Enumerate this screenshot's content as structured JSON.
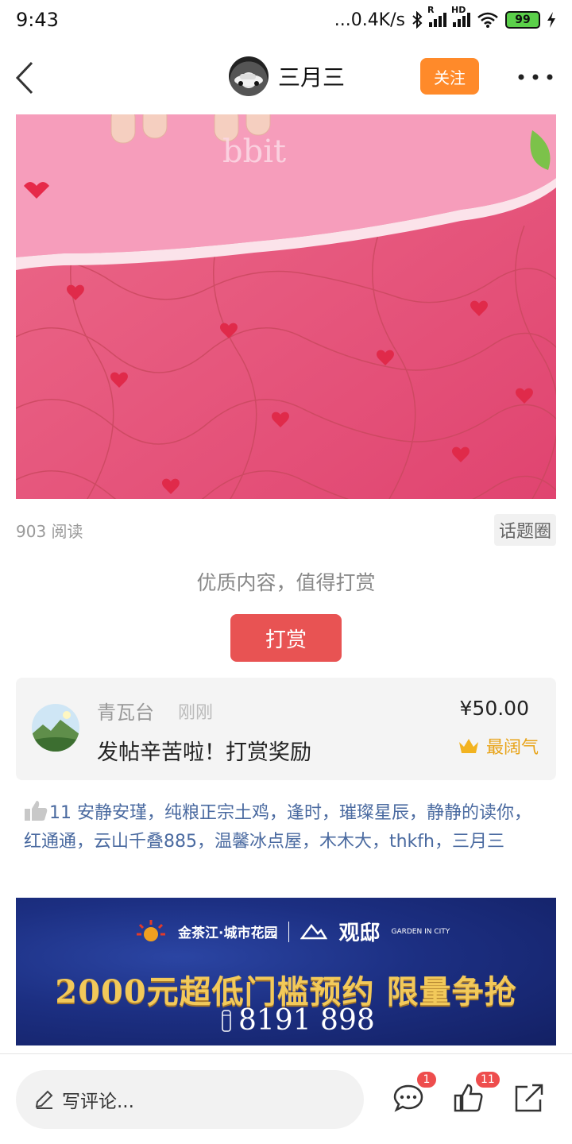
{
  "status_bar": {
    "time": "9:43",
    "network_speed": "...0.4K/s",
    "signal_label_1": "R",
    "signal_label_2": "HD",
    "battery": "99"
  },
  "header": {
    "username": "三月三",
    "follow_label": "关注"
  },
  "post": {
    "read_count": "903 阅读",
    "topic_tag": "话题圈"
  },
  "reward": {
    "hint": "优质内容，值得打赏",
    "button_label": "打赏",
    "tip": {
      "tipper_name": "青瓦台",
      "time": "刚刚",
      "message": "发帖辛苦啦！打赏奖励",
      "amount": "¥50.00",
      "badge": "最阔气"
    }
  },
  "likes": {
    "count": "11",
    "names": "安静安瑾，纯粮正宗土鸡，逢时，璀璨星辰，静静的读你，红通通，云山千叠885，温馨冰点屋，木木大，thkfh，三月三"
  },
  "ad": {
    "brand_cn": "金茶江·城市花园",
    "brand_en": "GARDEN IN CITY",
    "brand_2": "观邸",
    "headline": "2000元超低门槛预约 限量争抢",
    "phone": "8191 898"
  },
  "bottom_bar": {
    "comment_placeholder": "写评论...",
    "comment_count": "1",
    "like_count": "11"
  },
  "colors": {
    "follow_orange": "#ff8a2a",
    "reward_red": "#e85353",
    "link_blue": "#4a6aa0",
    "badge_red": "#ee4d4d",
    "crown_gold": "#e8a317"
  }
}
